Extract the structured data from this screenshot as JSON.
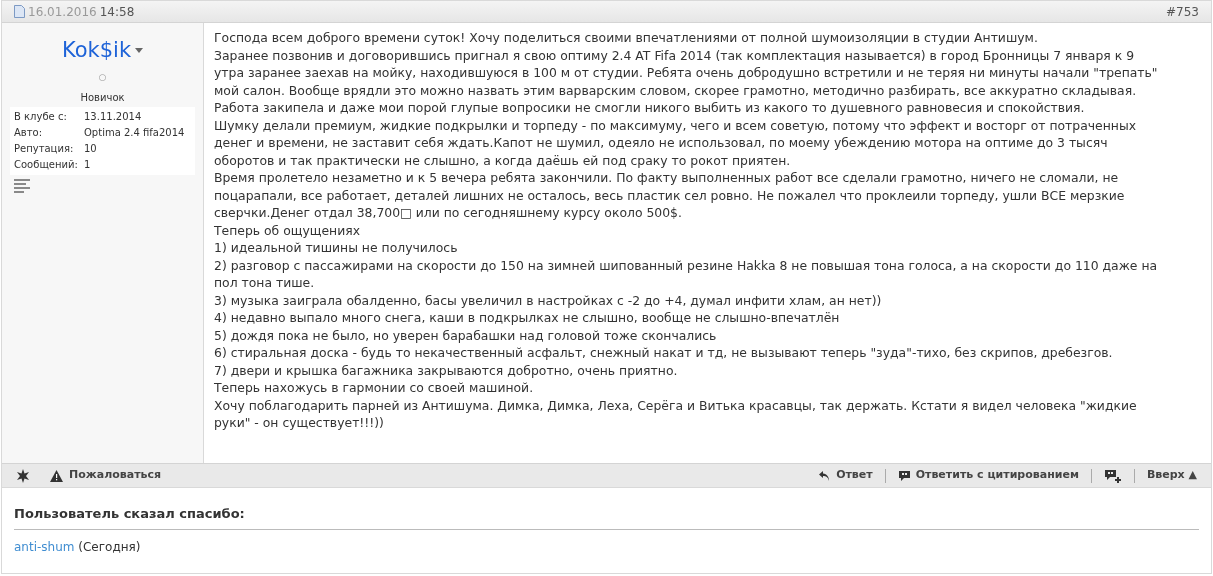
{
  "post_header": {
    "date": "16.01.2016",
    "time": "14:58",
    "number": "#753"
  },
  "user": {
    "name": "Kok$ik",
    "status_dot": "○",
    "rank": "Новичок",
    "fields": [
      {
        "label": "В клубе с:",
        "value": "13.11.2014"
      },
      {
        "label": "Авто:",
        "value": "Optima 2.4 fifa2014"
      },
      {
        "label": "Репутация:",
        "value": "10"
      },
      {
        "label": "Сообщений:",
        "value": "1"
      }
    ]
  },
  "post_lines": [
    "Господа всем доброго времени суток! Хочу поделиться своими впечатлениями от полной шумоизоляции в студии Антишум.",
    "Заранее позвонив и договорившись пригнал я свою оптиму 2.4 AT Fifa 2014 (так комплектация называется) в город Бронницы 7 января к 9",
    "утра заранее заехав на мойку, находившуюся в 100 м от студии. Ребята очень добродушно встретили и не теряя ни минуты начали \"трепать\"",
    "мой салон. Вообще врядли это можно назвать этим варварским словом, скорее грамотно, методично разбирать, все аккуратно складывая.",
    "Работа закипела и даже мои порой глупые вопросики не смогли никого выбить из какого то душевного равновесия и спокойствия.",
    "Шумку делали премиум, жидкие подкрылки и торпеду - по максимуму, чего и всем советую, потому что эффект и восторг от потраченных",
    "денег и времени, не заставит себя ждать.Капот не шумил, одеяло не использовал, по моему убеждению мотора на оптиме до 3 тысяч",
    "оборотов и так практически не слышно, а когда даёшь ей под сраку то рокот приятен.",
    "Время пролетело незаметно и к 5 вечера ребята закончили. По факту выполненных работ все сделали грамотно, ничего не сломали, не",
    "поцарапали, все работает, деталей лишних не осталось, весь пластик сел ровно. Не пожалел что проклеили торпеду, ушли ВСЕ мерзкие",
    "сверчки.Денег отдал 38,700□ или по сегодняшнему курсу около 500$.",
    "Теперь об ощущениях",
    "1) идеальной тишины не получилось",
    "2) разговор с пассажирами на скорости до 150 на зимней шипованный резине Hakka 8 не повышая тона голоса, а на скорости до 110 даже на",
    "пол тона тише.",
    "3) музыка заиграла обалденно, басы увеличил в настройках с -2 до +4, думал инфити хлам, ан нет))",
    "4) недавно выпало много снега, каши в подкрылках не слышно, вообще не слышно-впечатлён",
    "5) дождя пока не было, но уверен барабашки над головой тоже скончались",
    "6) стиральная доска - будь то некачественный асфальт, снежный накат и тд, не вызывают теперь \"зуда\"-тихо, без скрипов, дребезгов.",
    "7) двери и крышка багажника закрываются добротно, очень приятно.",
    "Теперь нахожусь в гармонии со своей машиной.",
    "Хочу поблагодарить парней из Антишума. Димка, Димка, Леха, Серёга и Витька красавцы, так держать. Кстати я видел человека \"жидкие",
    "руки\" - он существует!!!))"
  ],
  "footer": {
    "report": "Пожаловаться",
    "actions": [
      {
        "kind": "reply",
        "label": "Ответ"
      },
      {
        "kind": "quote",
        "label": "Ответить с цитированием"
      },
      {
        "kind": "multiquote"
      },
      {
        "kind": "top",
        "label": "Вверх ▲"
      }
    ]
  },
  "thanks": {
    "title": "Пользователь сказал спасибо:",
    "user": "anti-shum",
    "when": "(Сегодня)"
  }
}
